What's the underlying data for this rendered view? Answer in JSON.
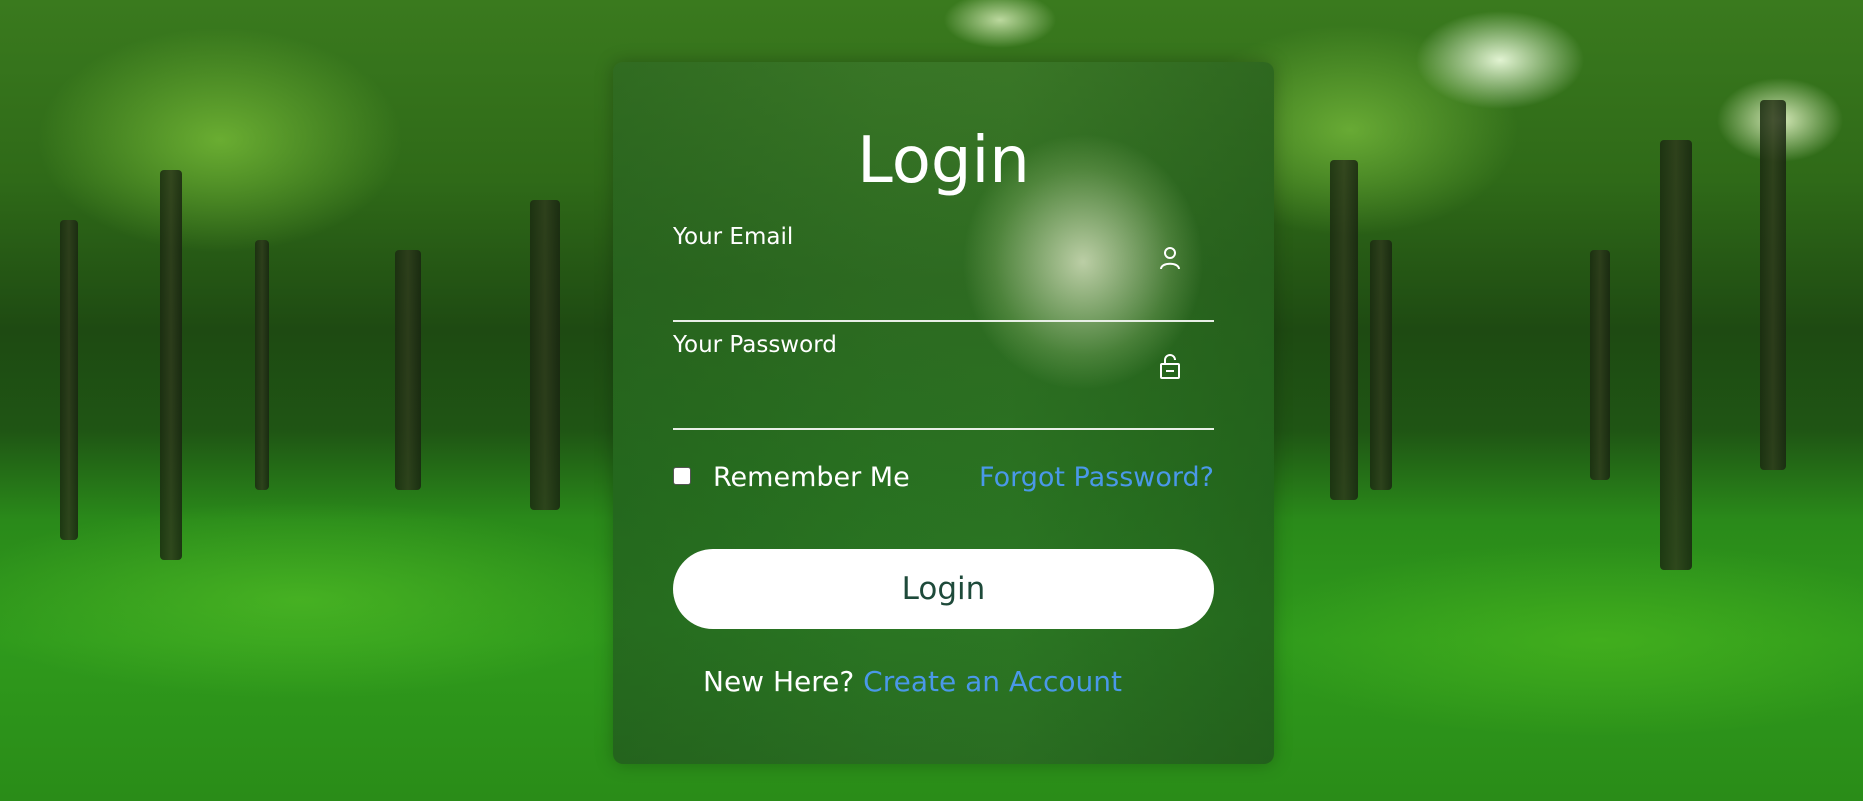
{
  "page": {
    "background": "forest park photo"
  },
  "login_card": {
    "title": "Login",
    "email": {
      "label": "Your Email",
      "value": "",
      "icon": "user-icon"
    },
    "password": {
      "label": "Your Password",
      "value": "",
      "icon": "unlock-icon"
    },
    "remember_me": {
      "label": "Remember Me",
      "checked": false
    },
    "forgot_password_link": "Forgot Password?",
    "login_button": "Login",
    "signup": {
      "prompt": "New Here?",
      "link": "Create an Account"
    }
  },
  "colors": {
    "link": "#4a98e8",
    "button_bg": "#ffffff",
    "button_text": "#1e4a3a",
    "text": "#ffffff"
  }
}
